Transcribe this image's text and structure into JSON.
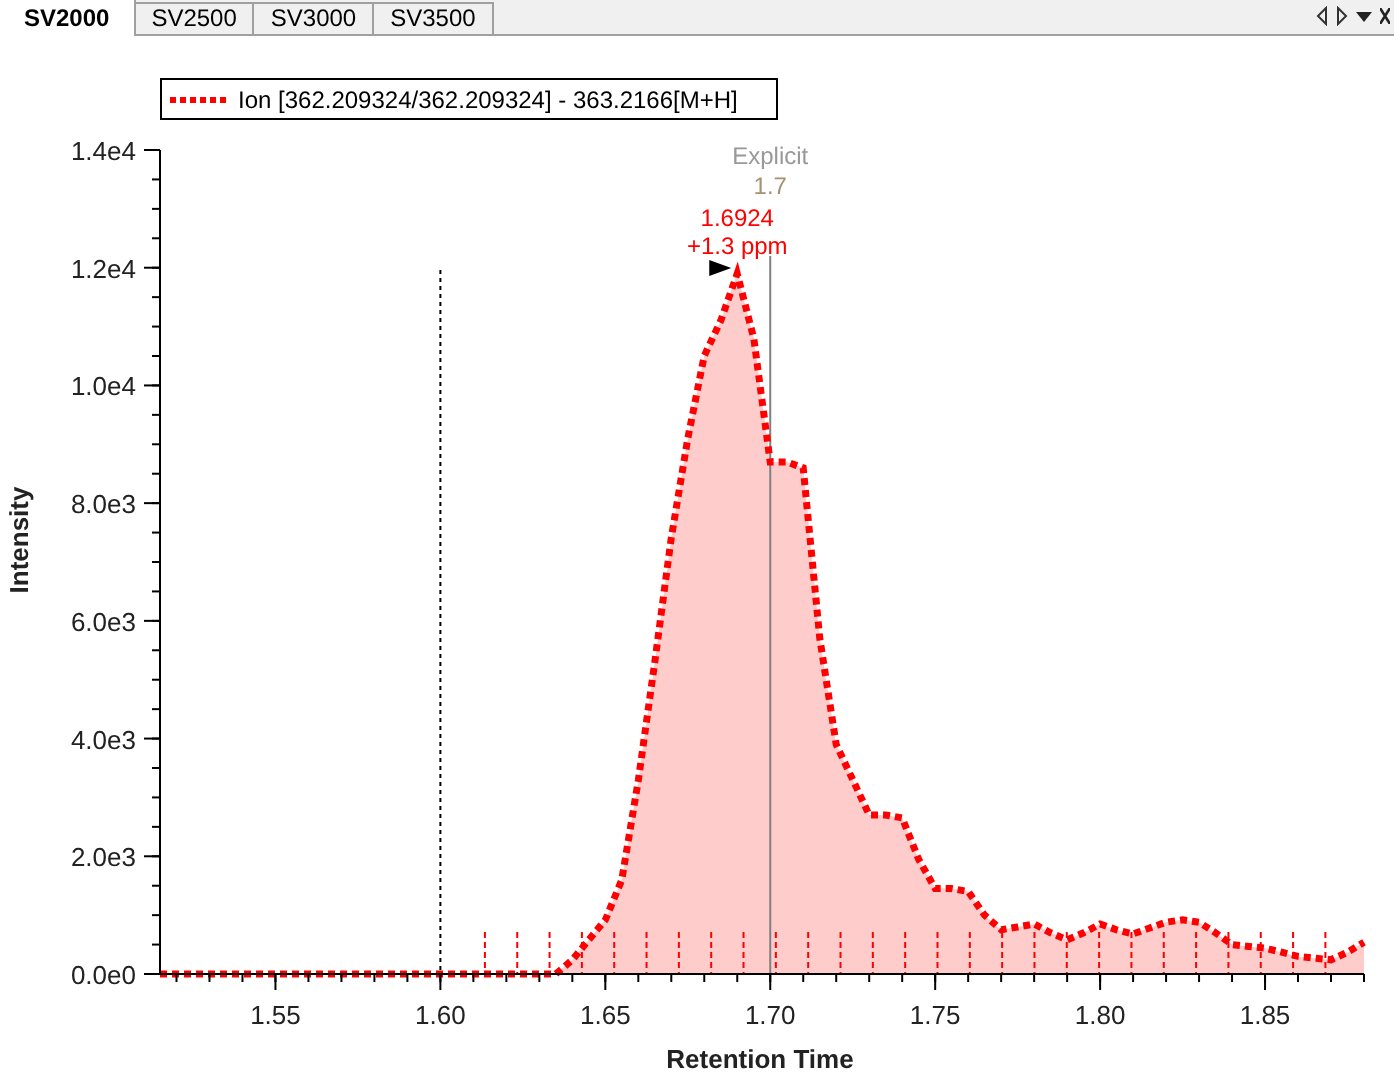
{
  "tabs": [
    {
      "label": "SV2000",
      "selected": true
    },
    {
      "label": "SV2500",
      "selected": false
    },
    {
      "label": "SV3000",
      "selected": false
    },
    {
      "label": "SV3500",
      "selected": false
    }
  ],
  "chart": {
    "chart_data": {
      "type": "area",
      "xlabel": "Retention Time",
      "ylabel": "Intensity",
      "x": [
        1.515,
        1.6,
        1.635,
        1.64,
        1.645,
        1.65,
        1.655,
        1.66,
        1.665,
        1.67,
        1.675,
        1.68,
        1.685,
        1.69,
        1.695,
        1.7,
        1.705,
        1.71,
        1.715,
        1.72,
        1.725,
        1.73,
        1.735,
        1.74,
        1.745,
        1.75,
        1.755,
        1.76,
        1.765,
        1.77,
        1.775,
        1.78,
        1.785,
        1.79,
        1.795,
        1.8,
        1.805,
        1.81,
        1.815,
        1.82,
        1.825,
        1.83,
        1.835,
        1.84,
        1.845,
        1.85,
        1.855,
        1.86,
        1.865,
        1.87,
        1.875,
        1.88
      ],
      "series": [
        {
          "name": "Ion [362.209324/362.209324] - 363.2166[M+H]",
          "color": "#ff0000",
          "values": [
            0,
            0,
            0,
            240,
            580,
            920,
            1600,
            3300,
            5300,
            7400,
            9100,
            10500,
            11100,
            11900,
            10800,
            8700,
            8700,
            8600,
            5700,
            3900,
            3300,
            2700,
            2700,
            2650,
            1950,
            1450,
            1450,
            1400,
            1000,
            750,
            800,
            850,
            700,
            580,
            700,
            850,
            750,
            680,
            780,
            880,
            920,
            880,
            700,
            500,
            470,
            440,
            370,
            300,
            270,
            240,
            370,
            540
          ]
        }
      ],
      "xlim": [
        1.515,
        1.88
      ],
      "ylim": [
        0,
        14000
      ],
      "xticks": [
        {
          "value": 1.55,
          "label": "1.55"
        },
        {
          "value": 1.6,
          "label": "1.60"
        },
        {
          "value": 1.65,
          "label": "1.65"
        },
        {
          "value": 1.7,
          "label": "1.70"
        },
        {
          "value": 1.75,
          "label": "1.75"
        },
        {
          "value": 1.8,
          "label": "1.80"
        },
        {
          "value": 1.85,
          "label": "1.85"
        }
      ],
      "yticks": [
        {
          "value": 0,
          "label": "0.0e0"
        },
        {
          "value": 2000,
          "label": "2.0e3"
        },
        {
          "value": 4000,
          "label": "4.0e3"
        },
        {
          "value": 6000,
          "label": "6.0e3"
        },
        {
          "value": 8000,
          "label": "8.0e3"
        },
        {
          "value": 10000,
          "label": "1.0e4"
        },
        {
          "value": 12000,
          "label": "1.2e4"
        },
        {
          "value": 14000,
          "label": "1.4e4"
        }
      ],
      "ref_lines": [
        {
          "axis": "x",
          "value": 1.6
        },
        {
          "axis": "x",
          "value": 1.7
        }
      ],
      "annotations": [
        {
          "text": "Explicit"
        },
        {
          "text": "1.7"
        },
        {
          "text": "1.6924"
        },
        {
          "text": "+1.3 ppm"
        }
      ]
    }
  }
}
